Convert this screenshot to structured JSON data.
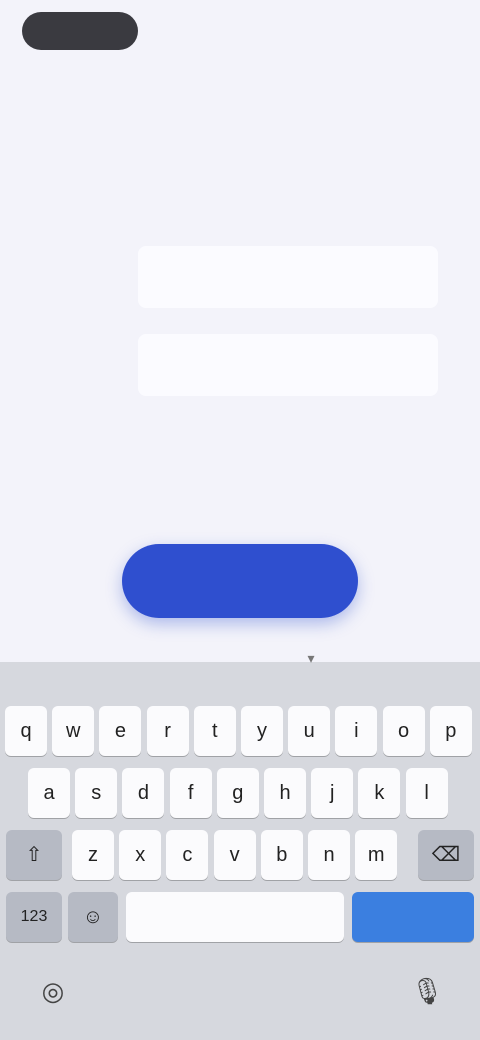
{
  "status_bar": {
    "center_text": "",
    "right_text": ""
  },
  "header": {
    "line1": "",
    "line2": ""
  },
  "form": {
    "field1": {
      "label": "",
      "value": "",
      "placeholder": ""
    },
    "field2": {
      "label": "",
      "value": "",
      "placeholder": ""
    }
  },
  "primary_button": {
    "label": ""
  },
  "keyboard": {
    "row1": [
      "q",
      "w",
      "e",
      "r",
      "t",
      "y",
      "u",
      "i",
      "o",
      "p"
    ],
    "row2": [
      "a",
      "s",
      "d",
      "f",
      "g",
      "h",
      "j",
      "k",
      "l"
    ],
    "row3": [
      "z",
      "x",
      "c",
      "v",
      "b",
      "n",
      "m"
    ],
    "shift_glyph": "⇧",
    "delete_glyph": "⌫",
    "numbers_label": "123",
    "emoji_glyph": "☺",
    "space_label": "",
    "return_label": "",
    "globe_glyph": "◎",
    "mic_glyph": "🎙"
  },
  "colors": {
    "background": "#f3f3fa",
    "primary": "#2f4fcf",
    "return_key": "#3b7fe0",
    "keyboard_bg": "#d6d8de"
  }
}
